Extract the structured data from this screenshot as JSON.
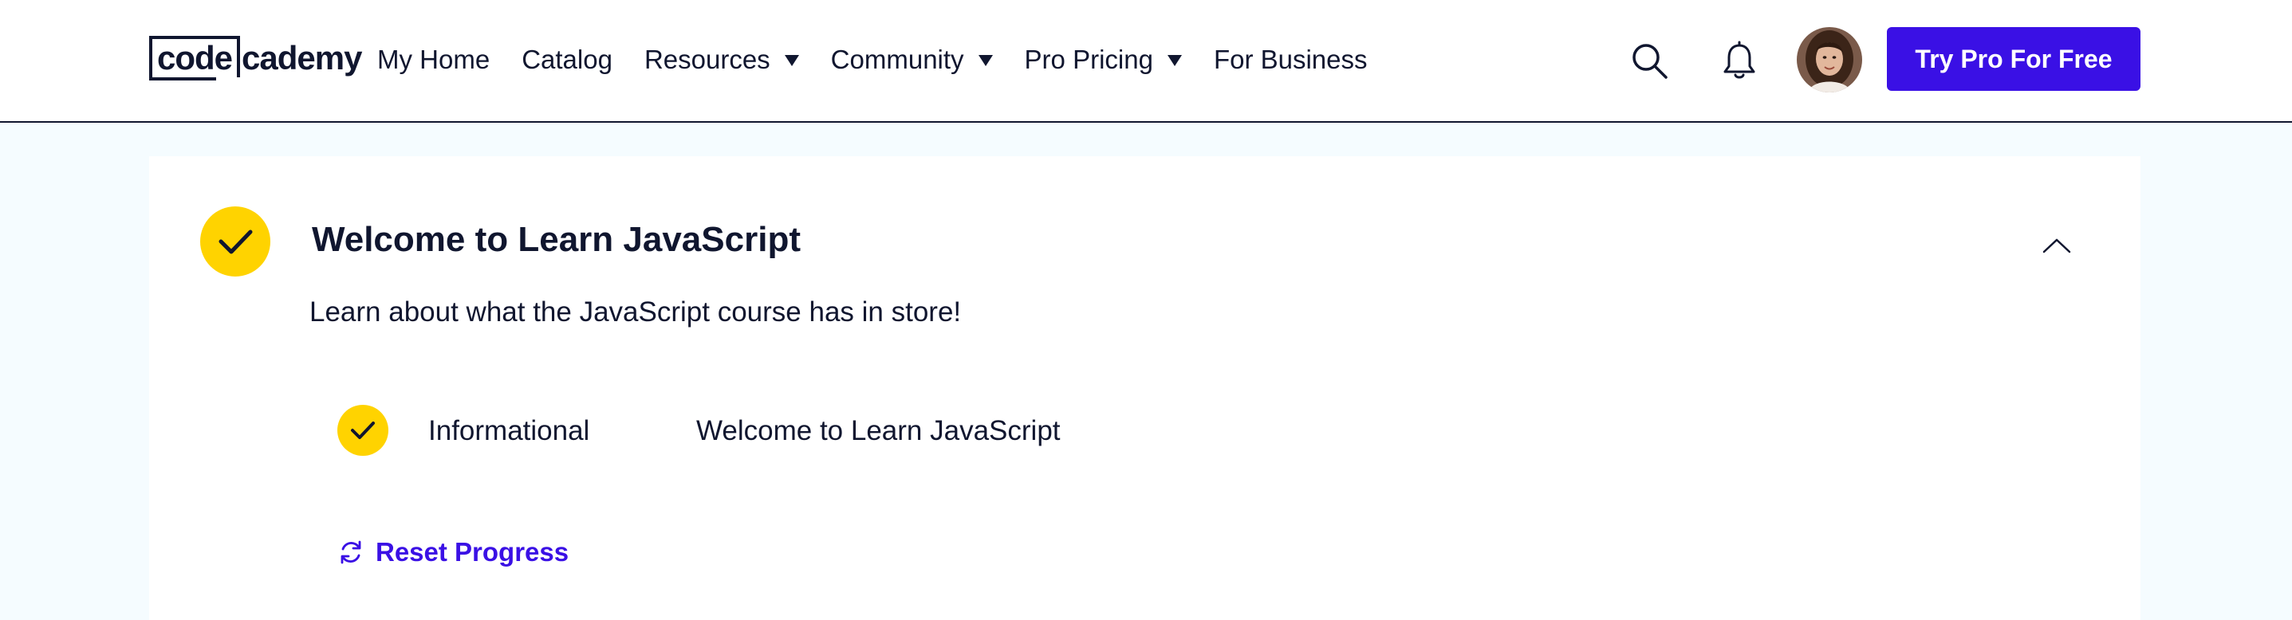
{
  "header": {
    "logo_boxed": "code",
    "logo_rest": "cademy",
    "nav": [
      {
        "label": "My Home",
        "dropdown": false
      },
      {
        "label": "Catalog",
        "dropdown": false
      },
      {
        "label": "Resources",
        "dropdown": true
      },
      {
        "label": "Community",
        "dropdown": true
      },
      {
        "label": "Pro Pricing",
        "dropdown": true
      },
      {
        "label": "For Business",
        "dropdown": false
      }
    ],
    "search_icon": "search-icon",
    "notifications_icon": "bell-icon",
    "cta_label": "Try Pro For Free"
  },
  "module": {
    "title": "Welcome to Learn JavaScript",
    "description": "Learn about what the JavaScript course has in store!",
    "completed": true,
    "expanded": true,
    "lessons": [
      {
        "type": "Informational",
        "name": "Welcome to Learn JavaScript",
        "completed": true
      }
    ],
    "reset_label": "Reset Progress"
  },
  "colors": {
    "accent": "#3a10e5",
    "check": "#ffd300",
    "text": "#10162f",
    "page_bg": "#f5fcff"
  }
}
